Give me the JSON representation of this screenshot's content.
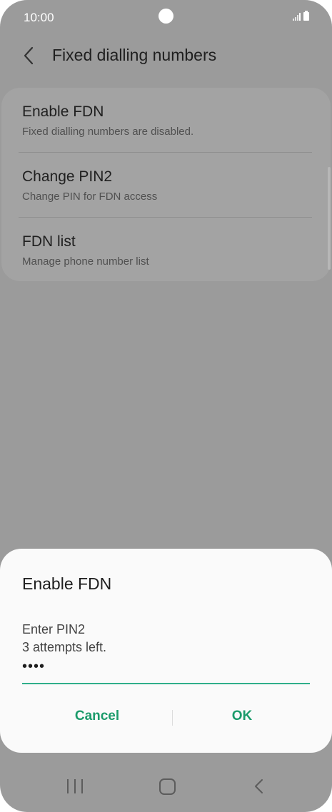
{
  "status_bar": {
    "time": "10:00"
  },
  "header": {
    "title": "Fixed dialling numbers"
  },
  "menu": {
    "items": [
      {
        "title": "Enable FDN",
        "subtitle": "Fixed dialling numbers are disabled."
      },
      {
        "title": "Change PIN2",
        "subtitle": "Change PIN for FDN access"
      },
      {
        "title": "FDN list",
        "subtitle": "Manage phone number list"
      }
    ]
  },
  "dialog": {
    "title": "Enable FDN",
    "message_line1": "Enter PIN2",
    "message_line2": "3 attempts left.",
    "pin_value": "••••",
    "cancel_label": "Cancel",
    "ok_label": "OK"
  },
  "colors": {
    "accent": "#1b9b6b",
    "underline": "#2fae8a",
    "dim_background": "#9b9b9b",
    "dialog_background": "#fafafa"
  },
  "icons": {
    "back": "chevron-left-icon",
    "nav_recent": "recent-apps-icon",
    "nav_home": "home-icon",
    "nav_back": "back-icon"
  }
}
